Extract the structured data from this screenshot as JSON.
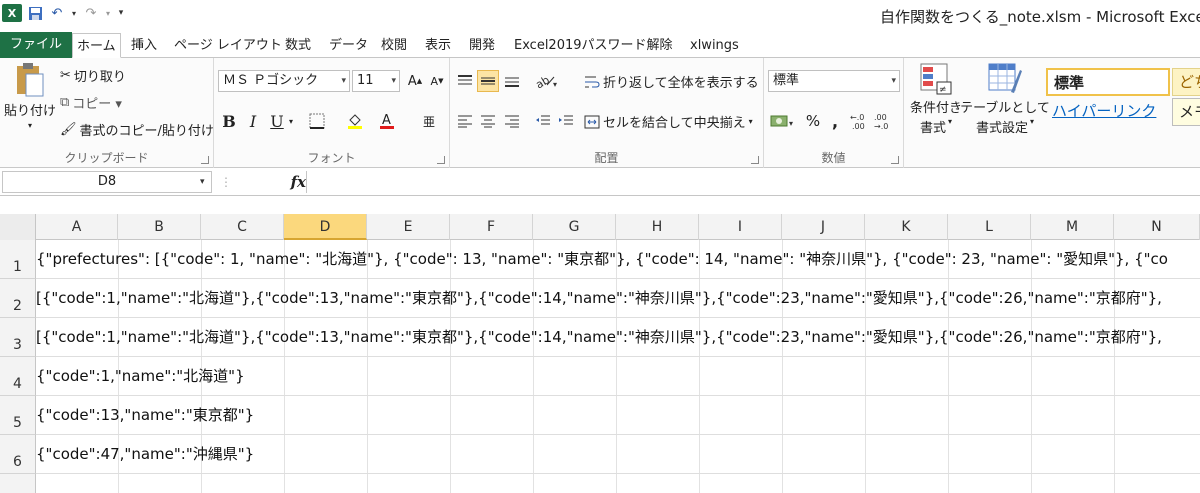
{
  "window": {
    "title": "自作関数をつくる_note.xlsm - Microsoft Excel"
  },
  "qat": {
    "logo": "X"
  },
  "tabs": [
    {
      "label": "ファイル"
    },
    {
      "label": "ホーム"
    },
    {
      "label": "挿入"
    },
    {
      "label": "ページ レイアウト"
    },
    {
      "label": "数式"
    },
    {
      "label": "データ"
    },
    {
      "label": "校閲"
    },
    {
      "label": "表示"
    },
    {
      "label": "開発"
    },
    {
      "label": "Excel2019パスワード解除"
    },
    {
      "label": "xlwings"
    }
  ],
  "clipboard": {
    "paste": "貼り付け",
    "cut": "切り取り",
    "copy": "コピー ▾",
    "format_painter": "書式のコピー/貼り付け",
    "label": "クリップボード"
  },
  "font": {
    "name": "ＭＳ Ｐゴシック",
    "size": "11",
    "label": "フォント",
    "bold": "B",
    "italic": "I",
    "underline": "U",
    "grow": "A",
    "shrink": "A"
  },
  "alignment": {
    "wrap": "折り返して全体を表示する",
    "merge": "セルを結合して中央揃え",
    "label": "配置"
  },
  "number": {
    "format": "標準",
    "percent": "%",
    "comma": ",",
    "label": "数値"
  },
  "styles": {
    "conditional_line1": "条件付き",
    "conditional_line2": "書式",
    "table_line1": "テーブルとして",
    "table_line2": "書式設定",
    "style_normal": "標準",
    "style_hyperlink": "ハイパーリンク",
    "style_bad": "どち",
    "style_memo": "メモ"
  },
  "formula_bar": {
    "name_box": "D8",
    "fx": "fx"
  },
  "columns": [
    "A",
    "B",
    "C",
    "D",
    "E",
    "F",
    "G",
    "H",
    "I",
    "J",
    "K",
    "L",
    "M",
    "N"
  ],
  "rows": [
    {
      "num": "1",
      "text": "{\"prefectures\": [{\"code\": 1, \"name\": \"北海道\"}, {\"code\": 13, \"name\": \"東京都\"}, {\"code\": 14, \"name\": \"神奈川県\"}, {\"code\": 23, \"name\": \"愛知県\"}, {\"co"
    },
    {
      "num": "2",
      "text": "[{\"code\":1,\"name\":\"北海道\"},{\"code\":13,\"name\":\"東京都\"},{\"code\":14,\"name\":\"神奈川県\"},{\"code\":23,\"name\":\"愛知県\"},{\"code\":26,\"name\":\"京都府\"},"
    },
    {
      "num": "3",
      "text": "[{\"code\":1,\"name\":\"北海道\"},{\"code\":13,\"name\":\"東京都\"},{\"code\":14,\"name\":\"神奈川県\"},{\"code\":23,\"name\":\"愛知県\"},{\"code\":26,\"name\":\"京都府\"},"
    },
    {
      "num": "4",
      "text": "{\"code\":1,\"name\":\"北海道\"}"
    },
    {
      "num": "5",
      "text": "{\"code\":13,\"name\":\"東京都\"}"
    },
    {
      "num": "6",
      "text": "{\"code\":47,\"name\":\"沖縄県\"}"
    }
  ],
  "colors": {
    "excel_green": "#1e7145",
    "selection": "#fbd87d"
  }
}
